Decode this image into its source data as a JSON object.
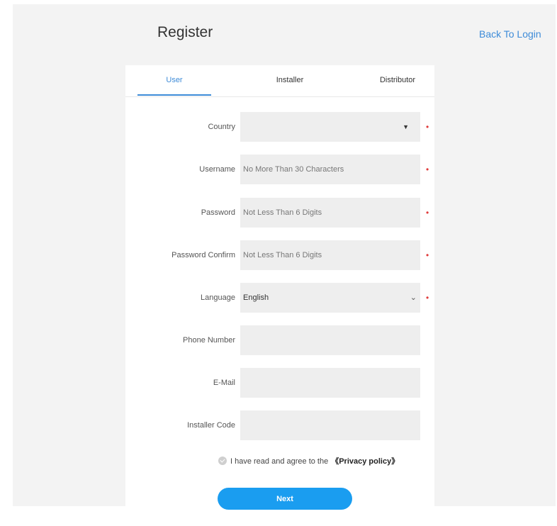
{
  "header": {
    "title": "Register",
    "back_link": "Back To Login"
  },
  "tabs": [
    {
      "label": "User",
      "active": true
    },
    {
      "label": "Installer",
      "active": false
    },
    {
      "label": "Distributor",
      "active": false
    }
  ],
  "form": {
    "country": {
      "label": "Country",
      "value": "",
      "required": true,
      "icon": "dropdown-caret-icon"
    },
    "username": {
      "label": "Username",
      "placeholder": "No More Than 30 Characters",
      "required": true
    },
    "password": {
      "label": "Password",
      "placeholder": "Not Less Than 6 Digits",
      "required": true
    },
    "password_confirm": {
      "label": "Password Confirm",
      "placeholder": "Not Less Than 6 Digits",
      "required": true
    },
    "language": {
      "label": "Language",
      "value": "English",
      "required": true,
      "icon": "chevron-down-icon"
    },
    "phone": {
      "label": "Phone Number",
      "value": ""
    },
    "email": {
      "label": "E-Mail",
      "value": ""
    },
    "installer_code": {
      "label": "Installer Code",
      "value": ""
    },
    "required_mark": "•"
  },
  "agreement": {
    "text": "I have read and agree to the",
    "link": "《Privacy policy》",
    "checked": true
  },
  "next_button": "Next",
  "colors": {
    "accent": "#3d8bd8",
    "button": "#1a9df0",
    "required": "#e03a3a",
    "field_bg": "#eeeeee",
    "page_bg": "#f3f3f3"
  }
}
